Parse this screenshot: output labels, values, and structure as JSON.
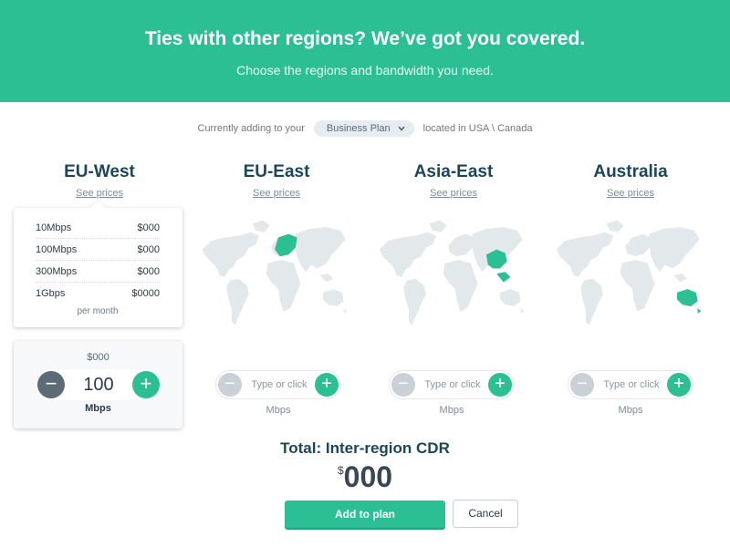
{
  "hero": {
    "title": "Ties with other regions? We’ve got you covered.",
    "subtitle": "Choose the regions and bandwidth you need."
  },
  "context": {
    "prefix": "Currently adding to your",
    "plan": "Business Plan",
    "suffix": "located in USA \\ Canada"
  },
  "regions": [
    {
      "name": "EU-West",
      "see_prices": "See prices",
      "unit": "Mbps",
      "placeholder": "Type or click"
    },
    {
      "name": "EU-East",
      "see_prices": "See prices",
      "unit": "Mbps",
      "placeholder": "Type or click"
    },
    {
      "name": "Asia-East",
      "see_prices": "See prices",
      "unit": "Mbps",
      "placeholder": "Type or click"
    },
    {
      "name": "Australia",
      "see_prices": "See prices",
      "unit": "Mbps",
      "placeholder": "Type or click"
    }
  ],
  "price_popup": {
    "rows": [
      {
        "tier": "10Mbps",
        "price": "$000"
      },
      {
        "tier": "100Mbps",
        "price": "$000"
      },
      {
        "tier": "300Mbps",
        "price": "$000"
      },
      {
        "tier": "1Gbps",
        "price": "$0000"
      }
    ],
    "note": "per month"
  },
  "active_selection": {
    "price": "$000",
    "value": "100",
    "unit": "Mbps"
  },
  "icons": {
    "minus": "−",
    "plus": "+",
    "dropdown": "chevron-down-icon"
  },
  "total": {
    "title": "Total: Inter-region CDR",
    "currency": "$",
    "amount": "000"
  },
  "actions": {
    "add": "Add to plan",
    "cancel": "Cancel"
  },
  "colors": {
    "accent": "#2cbf93",
    "heading": "#1d4659",
    "map_land": "#e3e8eb",
    "map_highlight": "#2cbf93"
  }
}
